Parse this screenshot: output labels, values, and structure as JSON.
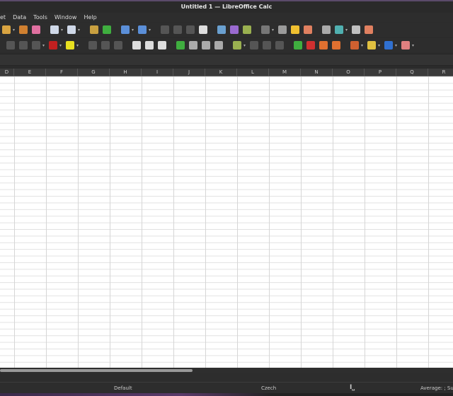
{
  "window": {
    "title": "Untitled 1 — LibreOffice Calc"
  },
  "menu": [
    "et",
    "Data",
    "Tools",
    "Window",
    "Help"
  ],
  "toolbar1": [
    {
      "icon": "paste-icon",
      "color": "#d9a441",
      "dd": true
    },
    {
      "icon": "clone-formatting-icon",
      "color": "#d08030"
    },
    {
      "icon": "clear-formatting-icon",
      "color": "#e070a0"
    },
    {
      "icon": "undo-icon",
      "color": "#cfd8e8",
      "dd": true
    },
    {
      "icon": "redo-icon",
      "color": "#cfd8e8",
      "dd": true
    },
    {
      "icon": "find-replace-icon",
      "color": "#c9a040"
    },
    {
      "icon": "spelling-icon",
      "color": "#3fae3f"
    },
    {
      "icon": "row-icon",
      "color": "#5b8fd8",
      "dd": true
    },
    {
      "icon": "column-icon",
      "color": "#5b8fd8",
      "dd": true
    },
    {
      "icon": "sort-icon",
      "color": "#555"
    },
    {
      "icon": "sort-ascending-icon",
      "color": "#555"
    },
    {
      "icon": "sort-descending-icon",
      "color": "#555"
    },
    {
      "icon": "autofilter-icon",
      "color": "#ddd"
    },
    {
      "icon": "insert-image-icon",
      "color": "#6aa0d0"
    },
    {
      "icon": "insert-chart-icon",
      "color": "#9a6ad0"
    },
    {
      "icon": "pivot-table-icon",
      "color": "#9ab050"
    },
    {
      "icon": "special-character-icon",
      "color": "#777",
      "dd": true
    },
    {
      "icon": "hyperlink-icon",
      "color": "#9a9a9a"
    },
    {
      "icon": "comment-icon",
      "color": "#f0c030"
    },
    {
      "icon": "header-footer-icon",
      "color": "#e08060"
    },
    {
      "icon": "define-print-area-icon",
      "color": "#aaa"
    },
    {
      "icon": "freeze-rows-columns-icon",
      "color": "#50b0b0",
      "dd": true
    },
    {
      "icon": "split-window-icon",
      "color": "#c0c0c0"
    },
    {
      "icon": "show-draw-functions-icon",
      "color": "#e08060"
    }
  ],
  "toolbar2": [
    {
      "icon": "bold-icon",
      "color": "#555"
    },
    {
      "icon": "italic-icon",
      "color": "#555"
    },
    {
      "icon": "underline-icon",
      "color": "#555",
      "dd": true
    },
    {
      "icon": "font-color-icon",
      "color": "#c02020",
      "dd": true
    },
    {
      "icon": "highlight-color-icon",
      "color": "#e8e020",
      "dd": true
    },
    {
      "icon": "align-left-icon",
      "color": "#555"
    },
    {
      "icon": "align-center-icon",
      "color": "#555"
    },
    {
      "icon": "align-right-icon",
      "color": "#555"
    },
    {
      "icon": "align-top-icon",
      "color": "#ddd"
    },
    {
      "icon": "align-middle-icon",
      "color": "#ddd"
    },
    {
      "icon": "align-bottom-icon",
      "color": "#ddd"
    },
    {
      "icon": "wrap-text-icon",
      "color": "#3fae3f"
    },
    {
      "icon": "merge-center-icon",
      "color": "#aaa"
    },
    {
      "icon": "merge-cells-icon",
      "color": "#aaa"
    },
    {
      "icon": "unmerge-cells-icon",
      "color": "#aaa"
    },
    {
      "icon": "number-format-icon",
      "color": "#9ab050",
      "dd": true
    },
    {
      "icon": "percent-icon",
      "color": "#555"
    },
    {
      "icon": "decimal-icon",
      "color": "#555"
    },
    {
      "icon": "date-icon",
      "color": "#555"
    },
    {
      "icon": "add-decimal-icon",
      "color": "#3fae3f"
    },
    {
      "icon": "delete-decimal-icon",
      "color": "#d03030"
    },
    {
      "icon": "increase-indent-icon",
      "color": "#e07030"
    },
    {
      "icon": "decrease-indent-icon",
      "color": "#e07030"
    },
    {
      "icon": "borders-icon",
      "color": "#d06030",
      "dd": true
    },
    {
      "icon": "border-style-icon",
      "color": "#e0c040",
      "dd": true
    },
    {
      "icon": "border-color-icon",
      "color": "#3070d0",
      "dd": true
    },
    {
      "icon": "conditional-format-icon",
      "color": "#e08080",
      "dd": true
    }
  ],
  "columns": [
    "D",
    "E",
    "F",
    "G",
    "H",
    "I",
    "J",
    "K",
    "L",
    "M",
    "N",
    "O",
    "P",
    "Q",
    "R"
  ],
  "status": {
    "page_style": "Default",
    "language": "Czech",
    "selection_mode_icon": "text-cursor-icon",
    "summary": "Average: ; Sum"
  }
}
